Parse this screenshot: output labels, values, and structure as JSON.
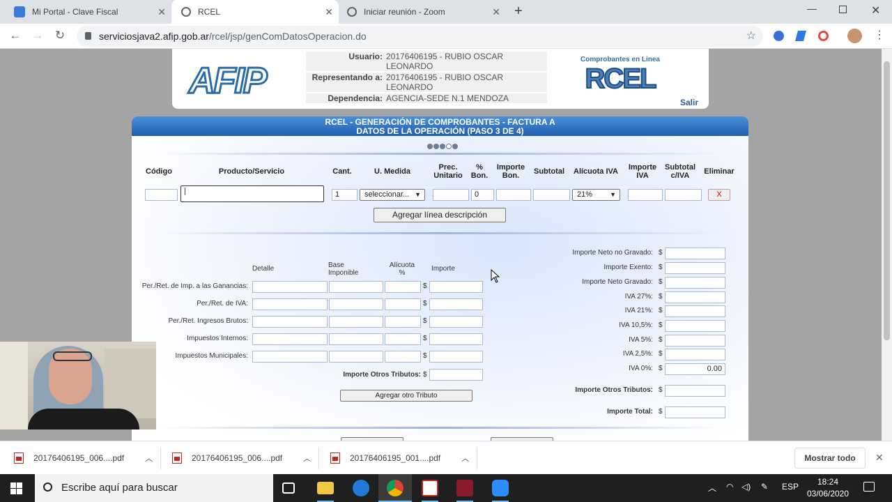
{
  "browser": {
    "tabs": [
      {
        "title": "Mi Portal - Clave Fiscal",
        "active": false,
        "favicon_color": "#3a7bd5"
      },
      {
        "title": "RCEL",
        "active": true,
        "favicon_color": "#5f6368"
      },
      {
        "title": "Iniciar reunión - Zoom",
        "active": false,
        "favicon_color": "#5f6368"
      }
    ],
    "url_host": "serviciosjava2.afip.gob.ar",
    "url_path": "/rcel/jsp/genComDatosOperacion.do"
  },
  "header": {
    "logo_text": "AFIP",
    "usuario_label": "Usuario:",
    "usuario_value": "20176406195 - RUBIO OSCAR LEONARDO",
    "representando_label": "Representando a:",
    "representando_value": "20176406195 - RUBIO OSCAR LEONARDO",
    "dependencia_label": "Dependencia:",
    "dependencia_value": "AGENCIA-SEDE N.1 MENDOZA",
    "rcel_caption": "Comprobantes en Linea",
    "rcel_logo": "RCEL",
    "salir": "Salir"
  },
  "form": {
    "title": "RCEL - GENERACIÓN DE COMPROBANTES - FACTURA A",
    "subtitle": "DATOS DE LA OPERACIÓN (PASO 3 DE 4)",
    "columns": {
      "codigo": "Código",
      "producto": "Producto/Servicio",
      "cant": "Cant.",
      "umedida": "U. Medida",
      "prec_unitario": "Prec. Unitario",
      "pct_bon": "% Bon.",
      "importe_bon": "Importe Bon.",
      "subtotal": "Subtotal",
      "alicuota_iva": "Alícuota IVA",
      "importe_iva": "Importe IVA",
      "subtotal_iva": "Subtotal c/IVA",
      "eliminar": "Eliminar"
    },
    "line": {
      "cantidad": "1",
      "umedida": "seleccionar...",
      "bonificacion": "0",
      "alicuota": "21%",
      "eliminar": "X"
    },
    "agregar_linea": "Agregar línea descripción",
    "tributos": {
      "col_detalle": "Detalle",
      "col_base": "Base Imponible",
      "col_alicuota": "Alícuota %",
      "col_importe": "Importe",
      "rows": [
        "Per./Ret. de Imp. a las Ganancias:",
        "Per./Ret. de IVA:",
        "Per./Ret. Ingresos Brutos:",
        "Impuestos Internos:",
        "Impuestos Municipales:"
      ],
      "otros_label": "Importe Otros Tributos:",
      "agregar": "Agregar otro Tributo"
    },
    "totales": [
      {
        "label": "Importe Neto no Gravado:",
        "value": ""
      },
      {
        "label": "Importe Exento:",
        "value": ""
      },
      {
        "label": "Importe Neto Gravado:",
        "value": ""
      },
      {
        "label": "IVA 27%:",
        "value": ""
      },
      {
        "label": "IVA 21%:",
        "value": ""
      },
      {
        "label": "IVA 10,5%:",
        "value": ""
      },
      {
        "label": "IVA 5%:",
        "value": ""
      },
      {
        "label": "IVA 2,5%:",
        "value": ""
      },
      {
        "label": "IVA 0%:",
        "value": "0.00"
      }
    ],
    "otros_tributos_label": "Importe Otros Tributos:",
    "total_label": "Importe Total:",
    "currency": "$"
  },
  "downloads": {
    "files": [
      "20176406195_006....pdf",
      "20176406195_006....pdf",
      "20176406195_001....pdf"
    ],
    "show_all": "Mostrar todo"
  },
  "taskbar": {
    "search_placeholder": "Escribe aquí para buscar",
    "language": "ESP",
    "time": "18:24",
    "date": "03/06/2020"
  }
}
